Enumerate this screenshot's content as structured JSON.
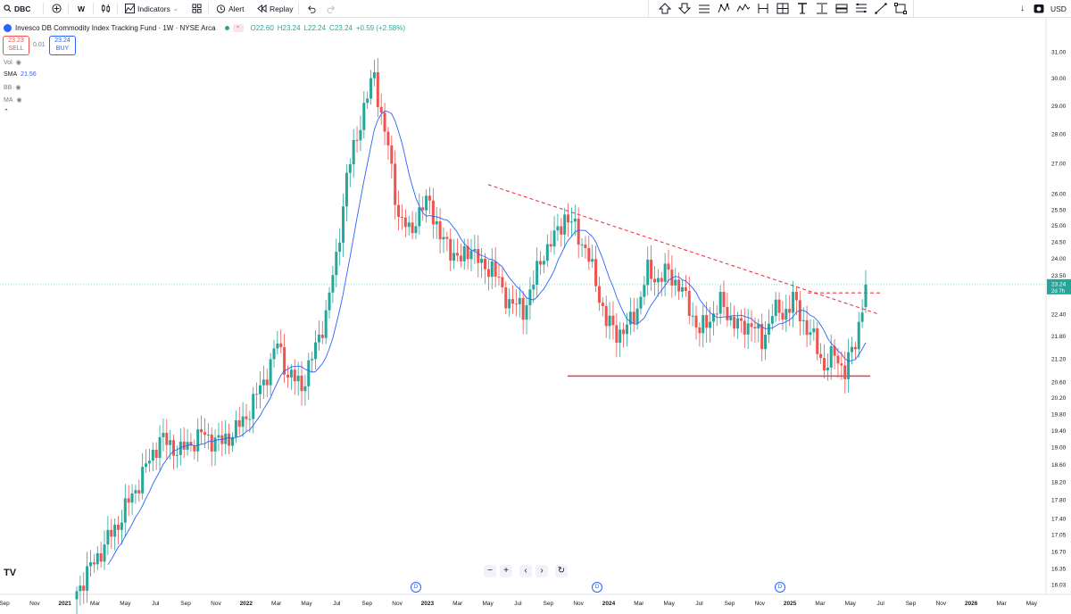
{
  "toolbar": {
    "symbol": "DBC",
    "interval": "W",
    "indicators_label": "Indicators",
    "alert_label": "Alert",
    "replay_label": "Replay",
    "currency": "USD"
  },
  "legend": {
    "title": "Invesco DB Commodity Index Tracking Fund · 1W · NYSE Arca",
    "open": "O22.60",
    "high": "H23.24",
    "low": "L22.24",
    "close": "C23.24",
    "change": "+0.59 (+2.58%)",
    "sell_price": "23.23",
    "sell_label": "SELL",
    "spread": "0.01",
    "buy_price": "23.24",
    "buy_label": "BUY",
    "indicators": [
      {
        "name": "Vol",
        "value": ""
      },
      {
        "name": "SMA",
        "value": "21.56"
      },
      {
        "name": "BB",
        "value": ""
      },
      {
        "name": "MA",
        "value": ""
      }
    ]
  },
  "price_badge": {
    "price": "23.24",
    "countdown": "2d 7h"
  },
  "colors": {
    "up": "#26a69a",
    "down": "#ef5350",
    "sma": "#2962ff",
    "accent": "#2962ff"
  },
  "chart_data": {
    "type": "candlestick",
    "title": "Invesco DB Commodity Index Tracking Fund · 1W · NYSE Arca",
    "y_ticks": [
      "31.00",
      "30.00",
      "29.00",
      "28.00",
      "27.00",
      "26.00",
      "25.50",
      "25.00",
      "24.50",
      "24.00",
      "23.50",
      "22.40",
      "21.80",
      "21.20",
      "20.60",
      "20.20",
      "19.80",
      "19.40",
      "19.00",
      "18.60",
      "18.20",
      "17.80",
      "17.40",
      "17.05",
      "16.70",
      "16.35",
      "16.03"
    ],
    "x_ticks": [
      "Sep",
      "Nov",
      "2021",
      "Mar",
      "May",
      "Jul",
      "Sep",
      "Nov",
      "2022",
      "Mar",
      "May",
      "Jul",
      "Sep",
      "Nov",
      "2023",
      "Mar",
      "May",
      "Jul",
      "Sep",
      "Nov",
      "2024",
      "Mar",
      "May",
      "Jul",
      "Sep",
      "Nov",
      "2025",
      "Mar",
      "May",
      "Jul",
      "Sep",
      "Nov",
      "2026",
      "Mar",
      "May"
    ],
    "log_scale": true,
    "ylim": [
      15.9,
      31.4
    ],
    "grid": false,
    "series": [
      {
        "name": "SMA",
        "style": "line"
      }
    ],
    "annotations": [
      {
        "type": "horizontal_line",
        "value": 20.75
      },
      {
        "type": "trendline_dashed",
        "from": {
          "x": "Jul 2023",
          "y": 26.3
        },
        "to": {
          "x": "Jul 2025",
          "y": 22.4
        }
      },
      {
        "type": "horizontal_ray_dashed",
        "value": 23.0
      }
    ]
  }
}
